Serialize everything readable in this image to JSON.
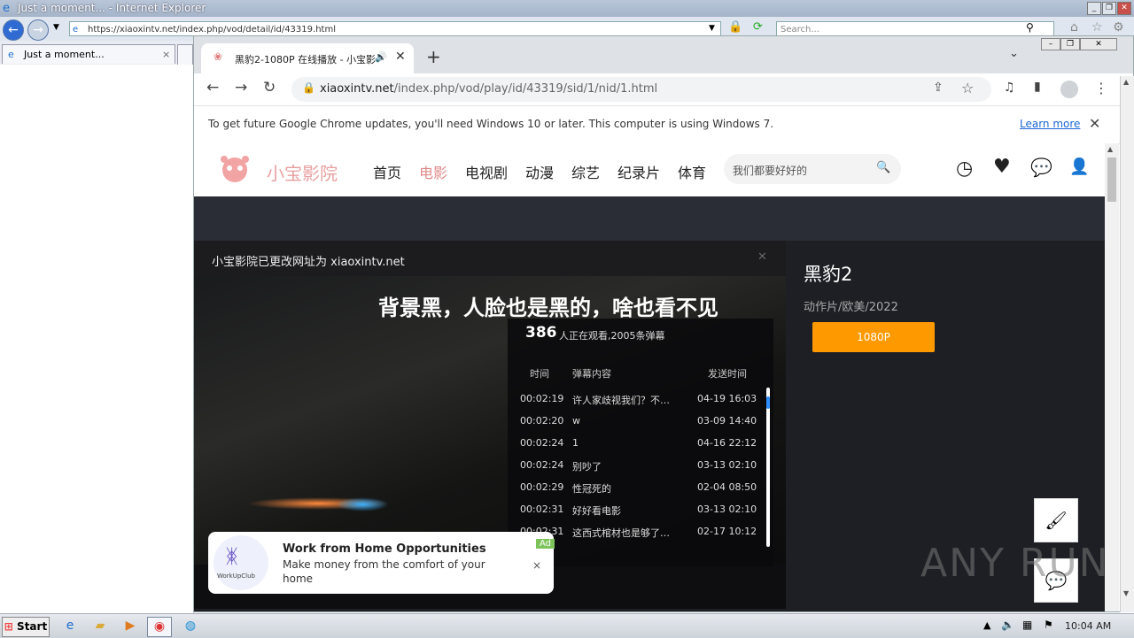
{
  "ie": {
    "title": "Just a moment... - Internet Explorer",
    "url": "https://xiaoxintv.net/index.php/vod/detail/id/43319.html",
    "search_placeholder": "Search...",
    "tab_label": "Just a moment..."
  },
  "chrome": {
    "tab_title": "黑豹2-1080P 在线播放 - 小宝影",
    "url_domain": "xiaoxintv.net",
    "url_path": "/index.php/vod/play/id/43319/sid/1/nid/1.html",
    "infobar_text": "To get future Google Chrome updates, you'll need Windows 10 or later. This computer is using Windows 7.",
    "infobar_link": "Learn more"
  },
  "site": {
    "logo_text": "小宝影院",
    "nav": [
      "首页",
      "电影",
      "电视剧",
      "动漫",
      "综艺",
      "纪录片",
      "体育"
    ],
    "active_nav": "电影",
    "search_placeholder": "我们都要好好的"
  },
  "player": {
    "notice": "小宝影院已更改网址为 xiaoxintv.net",
    "subtitle": "背景黑，人脸也是黑的，啥也看不见",
    "viewers_count": "386",
    "viewers_suffix": "人正在观看,2005条弹幕",
    "headers": {
      "time": "时间",
      "content": "弹幕内容",
      "sent": "发送时间"
    },
    "danmaku": [
      {
        "time": "00:02:19",
        "text": "许人家歧视我们？不…",
        "date": "04-19 16:03"
      },
      {
        "time": "00:02:20",
        "text": "w",
        "date": "03-09 14:40"
      },
      {
        "time": "00:02:24",
        "text": "1",
        "date": "04-16 22:12"
      },
      {
        "time": "00:02:24",
        "text": "别吵了",
        "date": "03-13 02:10"
      },
      {
        "time": "00:02:29",
        "text": "性冠死的",
        "date": "02-04 08:50"
      },
      {
        "time": "00:02:31",
        "text": "好好看电影",
        "date": "03-13 02:10"
      },
      {
        "time": "00:02:31",
        "text": "这西式棺材也是够了…",
        "date": "02-17 10:12"
      }
    ]
  },
  "movie": {
    "title": "黑豹2",
    "meta": "动作片/欧美/2022",
    "resolution": "1080P"
  },
  "ad": {
    "badge": "Ad",
    "title": "Work from Home Opportunities",
    "body": "Make money from the comfort of your home",
    "logo_text": "WorkUpClub"
  },
  "watermark": "ANY RUN",
  "taskbar": {
    "start": "Start",
    "clock": "10:04 AM"
  },
  "colors": {
    "accent_orange": "#ff9900",
    "nav_active": "#e08a8a",
    "dark_bg": "#1e1f25"
  }
}
